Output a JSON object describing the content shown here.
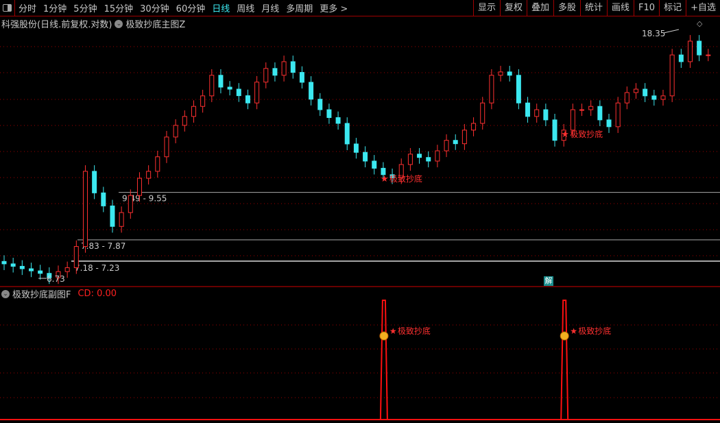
{
  "toolbar": {
    "periods": [
      "分时",
      "1分钟",
      "5分钟",
      "15分钟",
      "30分钟",
      "60分钟",
      "日线",
      "周线",
      "月线",
      "多周期",
      "更多 >"
    ],
    "active": "日线",
    "right": [
      "显示",
      "复权",
      "叠加",
      "多股",
      "统计",
      "画线",
      "F10",
      "标记",
      "+自选"
    ]
  },
  "main": {
    "title": "科强股份(日线.前复权.对数)",
    "indicator": "极致抄底主图Z",
    "max_label": "18.35",
    "min_label": "6.73",
    "price_ranges": [
      "9.49 - 9.55",
      "7.83 - 7.87",
      "7.18 - 7.23"
    ],
    "signal_label": "极致抄底",
    "jie": "解"
  },
  "sub": {
    "indicator": "极致抄底副图F",
    "cd": "CD: 0.00",
    "signal_label": "极致抄底"
  },
  "colors": {
    "up": "#ff3030",
    "down": "#3ce8f0",
    "grid": "#a00000",
    "accent": "#3ce8f0"
  },
  "chart_data": {
    "type": "candlestick",
    "scale": "log",
    "ylim": [
      6.73,
      18.35
    ],
    "closes": [
      7.12,
      7.05,
      6.98,
      6.92,
      6.85,
      6.73,
      6.9,
      7.01,
      7.64,
      10.37,
      9.5,
      9.01,
      8.29,
      8.77,
      9.4,
      10.08,
      10.37,
      11.0,
      11.92,
      12.5,
      12.96,
      13.5,
      14.09,
      15.32,
      14.6,
      14.48,
      14.1,
      13.69,
      14.9,
      15.75,
      15.32,
      16.19,
      15.5,
      14.89,
      13.9,
      13.32,
      12.9,
      12.6,
      11.59,
      11.2,
      10.81,
      10.5,
      10.23,
      10.1,
      10.66,
      11.12,
      10.97,
      10.81,
      11.27,
      11.76,
      11.6,
      12.26,
      12.6,
      13.69,
      15.32,
      15.53,
      15.32,
      13.69,
      12.96,
      13.32,
      12.78,
      11.76,
      12.26,
      13.32,
      13.32,
      13.5,
      12.78,
      12.43,
      13.69,
      14.28,
      14.48,
      14.09,
      13.89,
      14.09,
      16.64,
      16.19,
      17.6,
      16.64,
      16.64
    ],
    "signals_at": [
      42,
      62
    ]
  }
}
